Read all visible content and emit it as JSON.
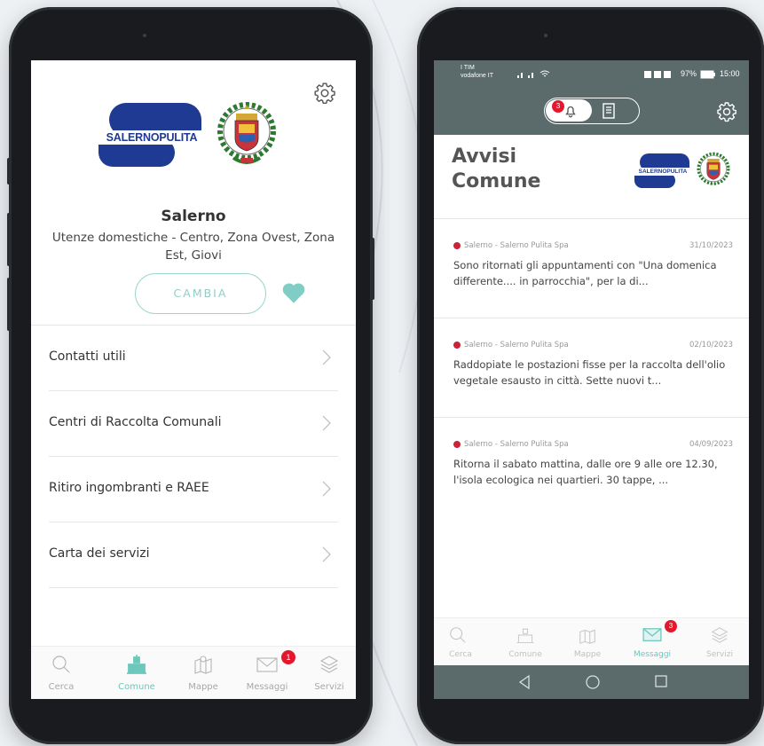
{
  "left_screen": {
    "city": "Salerno",
    "service_area": "Utenze domestiche - Centro, Zona Ovest, Zona Est, Giovi",
    "change_button": "CAMBIA",
    "logo_text": "SALERNOPULITA",
    "menu": [
      {
        "label": "Contatti utili"
      },
      {
        "label": "Centri di Raccolta Comunali"
      },
      {
        "label": "Ritiro ingombranti e RAEE"
      },
      {
        "label": "Carta dei servizi"
      }
    ],
    "tabs": [
      {
        "label": "Cerca",
        "icon": "search-icon"
      },
      {
        "label": "Comune",
        "icon": "town-hall-icon",
        "active": true
      },
      {
        "label": "Mappe",
        "icon": "map-icon"
      },
      {
        "label": "Messaggi",
        "icon": "envelope-icon",
        "badge": "1"
      },
      {
        "label": "Servizi",
        "icon": "layers-icon"
      }
    ]
  },
  "right_screen": {
    "status": {
      "carrier_line1": "I TIM",
      "carrier_line2": "vodafone IT",
      "battery": "97%",
      "time": "15:00"
    },
    "toggle_badge": "3",
    "title_line1": "Avvisi",
    "title_line2": "Comune",
    "logo_text": "SALERNOPULITA",
    "news": [
      {
        "source": "Salerno - Salerno Pulita Spa",
        "date": "31/10/2023",
        "text": "Sono ritornati gli appuntamenti con \"Una domenica differente.... in parrocchia\", per la di..."
      },
      {
        "source": "Salerno - Salerno Pulita Spa",
        "date": "02/10/2023",
        "text": "Raddopiate le postazioni fisse per la raccolta dell'olio vegetale esausto in città. Sette nuovi t..."
      },
      {
        "source": "Salerno - Salerno Pulita Spa",
        "date": "04/09/2023",
        "text": "Ritorna il sabato mattina, dalle ore 9 alle ore 12.30, l'isola ecologica nei quartieri. 30 tappe, ..."
      }
    ],
    "tabs": [
      {
        "label": "Cerca",
        "icon": "search-icon"
      },
      {
        "label": "Comune",
        "icon": "town-hall-icon"
      },
      {
        "label": "Mappe",
        "icon": "map-icon"
      },
      {
        "label": "Messaggi",
        "icon": "envelope-icon",
        "active": true,
        "badge": "3"
      },
      {
        "label": "Servizi",
        "icon": "layers-icon"
      }
    ]
  },
  "colors": {
    "accent_teal": "#6cc7bd",
    "brand_blue": "#1f3a93",
    "header_gray": "#5b6a6b",
    "badge_red": "#e3182d"
  }
}
